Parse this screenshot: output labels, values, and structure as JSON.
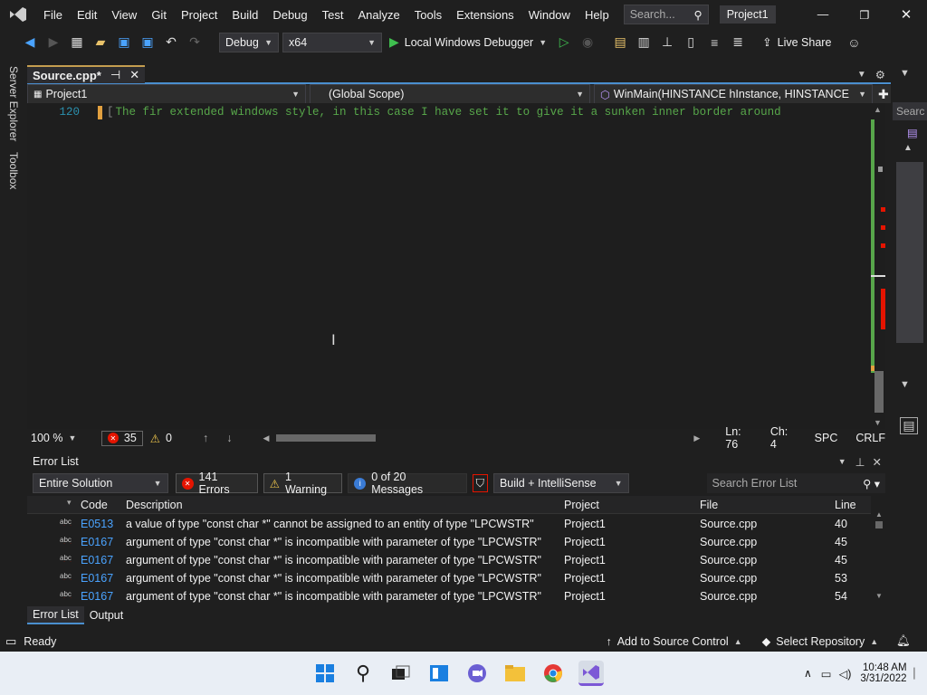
{
  "menu": {
    "items": [
      "File",
      "Edit",
      "View",
      "Git",
      "Project",
      "Build",
      "Debug",
      "Test",
      "Analyze",
      "Tools",
      "Extensions",
      "Window",
      "Help"
    ],
    "search_placeholder": "Search...",
    "project_name": "Project1"
  },
  "toolbar": {
    "config": "Debug",
    "platform": "x64",
    "run_label": "Local Windows Debugger",
    "live_share": "Live Share"
  },
  "left_rail": {
    "server_explorer": "Server Explorer",
    "toolbox": "Toolbox"
  },
  "right_rail": {
    "search_label": "Searc"
  },
  "doc_tab": {
    "label": "Source.cpp*"
  },
  "navbar": {
    "project": "Project1",
    "scope": "(Global Scope)",
    "function": "WinMain(HINSTANCE hInstance, HINSTANCE hPrev"
  },
  "editor": {
    "line_number": "120",
    "line_text": "The fir extended windows style, in this case I have set it to give it a sunken inner border around"
  },
  "editor_status": {
    "zoom": "100 %",
    "errors": "35",
    "warnings": "0",
    "ln": "Ln: 76",
    "ch": "Ch: 4",
    "spc": "SPC",
    "crlf": "CRLF"
  },
  "error_list": {
    "title": "Error List",
    "scope": "Entire Solution",
    "errors_btn": "141 Errors",
    "warnings_btn": "1 Warning",
    "messages_btn": "0 of 20 Messages",
    "build_filter": "Build + IntelliSense",
    "search_placeholder": "Search Error List",
    "columns": {
      "code": "Code",
      "description": "Description",
      "project": "Project",
      "file": "File",
      "line": "Line"
    },
    "rows": [
      {
        "badge": "abc",
        "code": "E0513",
        "description": "a value of type \"const char *\" cannot be assigned to an entity of type \"LPCWSTR\"",
        "project": "Project1",
        "file": "Source.cpp",
        "line": "40"
      },
      {
        "badge": "abc",
        "code": "E0167",
        "description": "argument of type \"const char *\" is incompatible with parameter of type \"LPCWSTR\"",
        "project": "Project1",
        "file": "Source.cpp",
        "line": "45"
      },
      {
        "badge": "abc",
        "code": "E0167",
        "description": "argument of type \"const char *\" is incompatible with parameter of type \"LPCWSTR\"",
        "project": "Project1",
        "file": "Source.cpp",
        "line": "45"
      },
      {
        "badge": "abc",
        "code": "E0167",
        "description": "argument of type \"const char *\" is incompatible with parameter of type \"LPCWSTR\"",
        "project": "Project1",
        "file": "Source.cpp",
        "line": "53"
      },
      {
        "badge": "abc",
        "code": "E0167",
        "description": "argument of type \"const char *\" is incompatible with parameter of type \"LPCWSTR\"",
        "project": "Project1",
        "file": "Source.cpp",
        "line": "54"
      }
    ],
    "tabs": [
      "Error List",
      "Output"
    ]
  },
  "app_status": {
    "ready": "Ready",
    "add_source": "Add to Source Control",
    "select_repo": "Select Repository"
  },
  "taskbar": {
    "time": "10:48 AM",
    "date": "3/31/2022"
  },
  "colors": {
    "accent": "#4aa3ff",
    "error": "#e51400",
    "warning": "#f2c94c",
    "comment": "#57a64a",
    "vs_purple": "#7c58d6"
  }
}
